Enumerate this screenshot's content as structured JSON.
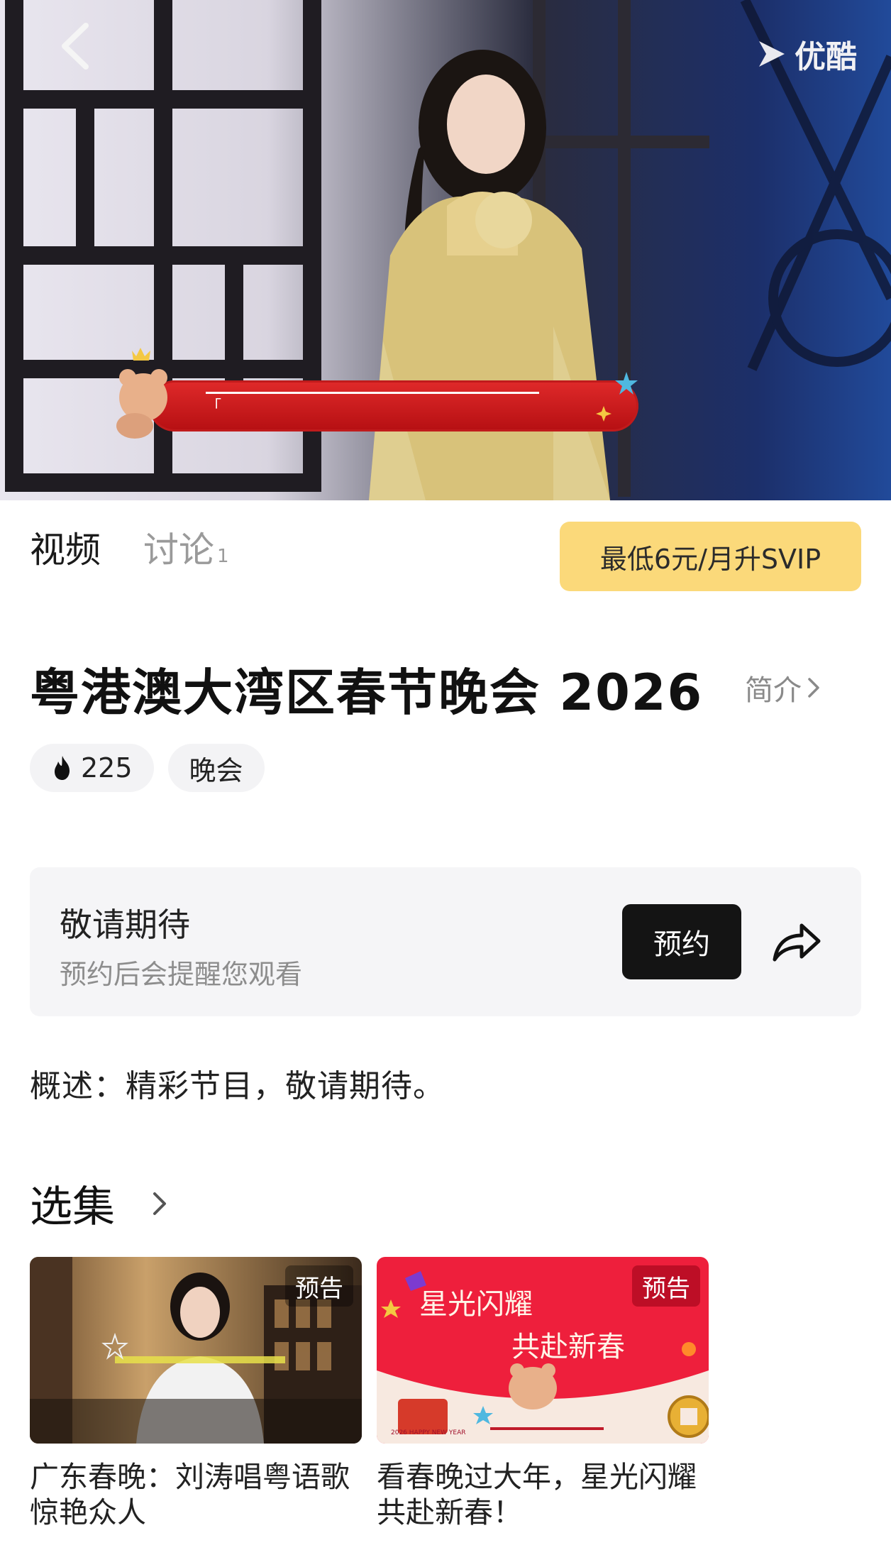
{
  "hero": {
    "logo_text": "优酷",
    "back_icon": "chevron-left-icon",
    "banner_text": "「"
  },
  "tabs": [
    {
      "label": "视频",
      "active": true
    },
    {
      "label": "讨论",
      "count": "1",
      "active": false
    }
  ],
  "svip_button": "最低6元/月升SVIP",
  "show": {
    "title": "粤港澳大湾区春节晚会 2026",
    "intro_link": "简介",
    "heat": "225",
    "category_tag": "晚会"
  },
  "reserve": {
    "title": "敬请期待",
    "subtitle": "预约后会提醒您观看",
    "button": "预约",
    "share_icon": "share-icon"
  },
  "description": "概述：精彩节目，敬请期待。",
  "episodes": {
    "header": "选集",
    "items": [
      {
        "badge": "预告",
        "caption": "广东春晚：刘涛唱粤语歌惊艳众人"
      },
      {
        "badge": "预告",
        "caption": "看春晚过大年，星光闪耀共赴新春！",
        "art_line1": "星光闪耀",
        "art_line2": "共赴新春",
        "art_small": "2026 HAPPY NEW YEAR"
      }
    ]
  },
  "colors": {
    "svip_bg": "#fbd97a",
    "reserve_btn": "#141414",
    "thumb2_red": "#ee1f3c"
  }
}
